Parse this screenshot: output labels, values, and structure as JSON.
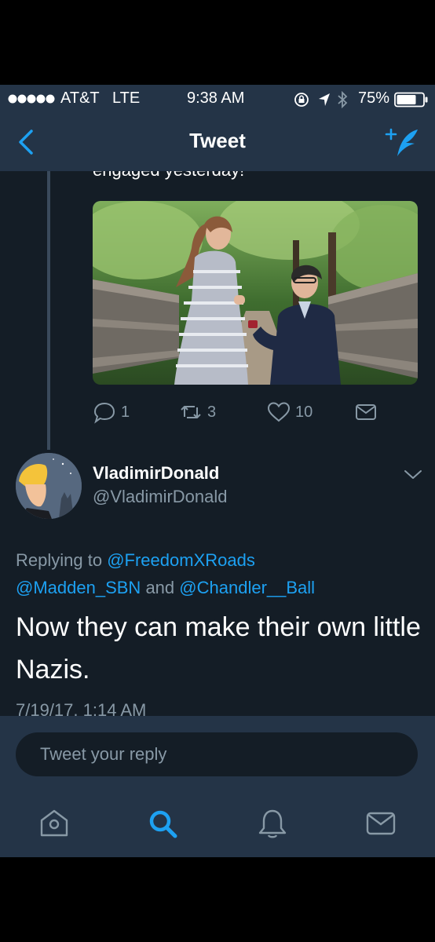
{
  "status_bar": {
    "carrier": "AT&T",
    "network": "LTE",
    "time": "9:38 AM",
    "battery": "75%",
    "signal_dots": 5,
    "battery_level": 0.75,
    "icons": [
      "signal-dots-icon",
      "rotation-lock-icon",
      "location-arrow-icon",
      "bluetooth-icon",
      "battery-icon"
    ]
  },
  "nav": {
    "title": "Tweet",
    "back_icon": "chevron-left-icon",
    "compose_icon": "compose-tweet-icon"
  },
  "quoted_tweet": {
    "cut_text": "engaged yesterday!",
    "media_description": "photo",
    "actions": {
      "reply_count": "1",
      "retweet_count": "3",
      "like_count": "10"
    }
  },
  "tweet": {
    "display_name": "VladimirDonald",
    "handle": "@VladimirDonald",
    "replying_prefix": "Replying to",
    "replying_to": [
      "@FreedomXRoads",
      "@Madden_SBN",
      "@Chandler__Ball"
    ],
    "replying_joiner": "and",
    "body": "Now they can make their own little Nazis.",
    "timestamp": "7/19/17, 1:14 AM"
  },
  "reply_bar": {
    "placeholder": "Tweet your reply"
  },
  "tab_bar": {
    "items": [
      "home-icon",
      "search-icon",
      "notifications-icon",
      "messages-icon"
    ],
    "active": "search-icon"
  },
  "colors": {
    "bar_bg": "#243447",
    "content_bg": "#141d26",
    "accent": "#1da1f2",
    "muted": "#8899a6"
  }
}
